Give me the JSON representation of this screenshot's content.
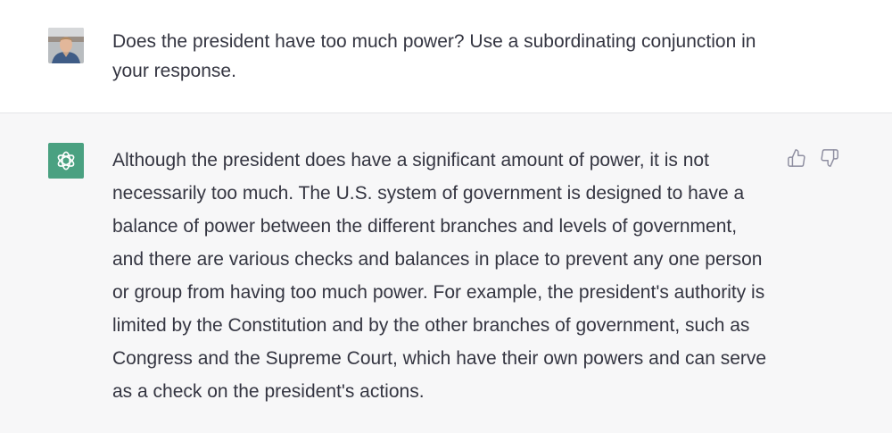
{
  "conversation": {
    "user_message": {
      "text": "Does the president have too much power? Use a subordinating conjunction in your response.",
      "avatar": "user-photo-avatar"
    },
    "assistant_message": {
      "text": "Although the president does have a significant amount of power, it is not necessarily too much. The U.S. system of government is designed to have a balance of power between the different branches and levels of government, and there are various checks and balances in place to prevent any one person or group from having too much power. For example, the president's authority is limited by the Constitution and by the other branches of government, such as Congress and the Supreme Court, which have their own powers and can serve as a check on the president's actions.",
      "avatar": "openai-logo-icon",
      "feedback": {
        "thumbs_up_icon": "thumbs-up-icon",
        "thumbs_down_icon": "thumbs-down-icon"
      }
    }
  },
  "colors": {
    "assistant_bg": "#f7f7f8",
    "user_bg": "#ffffff",
    "bot_avatar_bg": "#4aa181",
    "text": "#343541",
    "icon": "#8e8ea0"
  }
}
